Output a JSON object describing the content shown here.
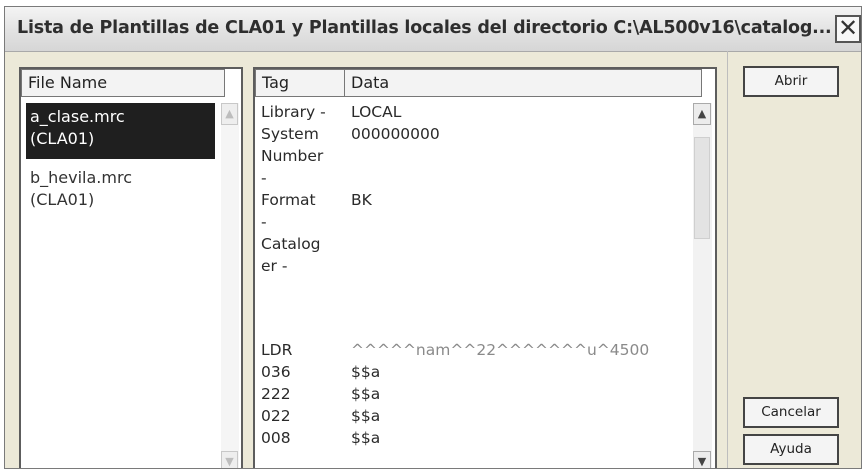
{
  "window": {
    "title": "Lista de Plantillas de CLA01 y Plantillas locales del directorio C:\\AL500v16\\catalog...",
    "close_glyph": "✕"
  },
  "files": {
    "header": "File Name",
    "items": [
      {
        "name": "a_clase.mrc",
        "lib": "(CLA01)",
        "selected": true
      },
      {
        "name": "b_hevila.mrc",
        "lib": "(CLA01)",
        "selected": false
      }
    ]
  },
  "record": {
    "headers": {
      "tag": "Tag",
      "data": "Data"
    },
    "fields": [
      {
        "tag_lines": [
          "Library -"
        ],
        "value": "LOCAL"
      },
      {
        "tag_lines": [
          "System",
          "Number",
          "-"
        ],
        "value": "000000000"
      },
      {
        "tag_lines": [
          "Format",
          "-"
        ],
        "value": "BK"
      },
      {
        "tag_lines": [
          "Catalog",
          "er -"
        ],
        "value": ""
      },
      {
        "tag_lines": [
          "LDR"
        ],
        "value": "^^^^^nam^^22^^^^^^^u^4500"
      },
      {
        "tag_lines": [
          "036"
        ],
        "value": "$$a"
      },
      {
        "tag_lines": [
          "222"
        ],
        "value": "$$a"
      },
      {
        "tag_lines": [
          "022"
        ],
        "value": "$$a"
      },
      {
        "tag_lines": [
          "008"
        ],
        "value": "$$a"
      }
    ]
  },
  "buttons": {
    "open": "Abrir",
    "cancel": "Cancelar",
    "help": "Ayuda"
  },
  "icons": {
    "scroll_up": "chevron-up-icon",
    "scroll_down": "chevron-down-icon"
  }
}
